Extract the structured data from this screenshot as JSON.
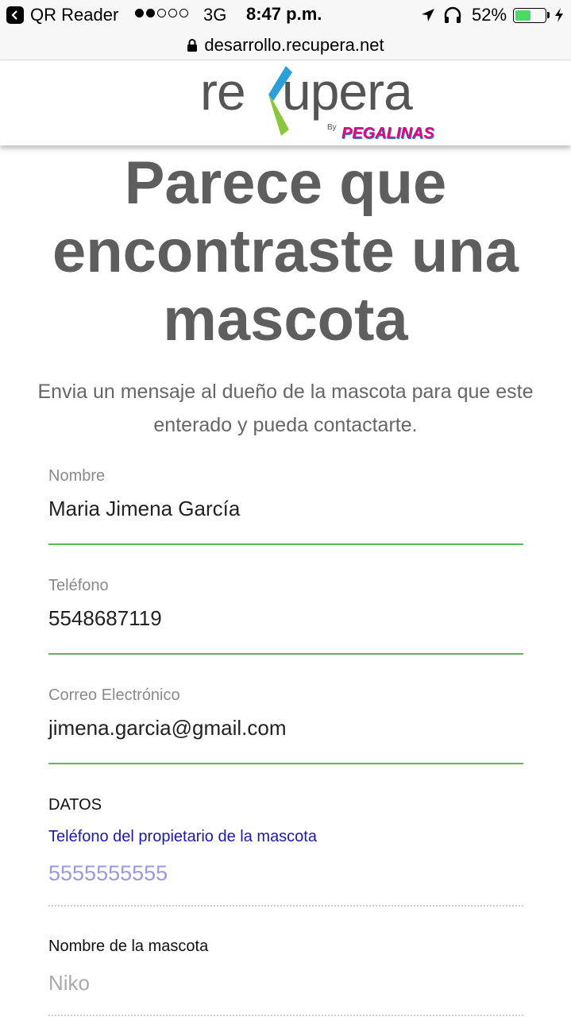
{
  "status_bar": {
    "app_name": "QR Reader",
    "network": "3G",
    "time": "8:47 p.m.",
    "battery": "52%",
    "battery_level": 0.52,
    "battery_color": "#4cd964"
  },
  "url_bar": {
    "url": "desarrollo.recupera.net",
    "icon": "lock-icon"
  },
  "header": {
    "logo_text_1": "re",
    "logo_text_2": "upera",
    "logo_by": "By",
    "logo_brand": "PEGALINAS",
    "logo_colors": [
      "#2a9fd8",
      "#8cc63f",
      "#e6007e"
    ]
  },
  "main": {
    "headline_lines": [
      "Parece que",
      "encontraste una",
      "mascota"
    ],
    "subtext": "Envia un mensaje al dueño de la mascota para que este enterado y pueda contactarte.",
    "form": {
      "name": {
        "label": "Nombre",
        "value": "Maria Jimena García"
      },
      "phone": {
        "label": "Teléfono",
        "value": "5548687119"
      },
      "email": {
        "label": "Correo Electrónico",
        "value": "jimena.garcia@gmail.com"
      },
      "underline_color": "#5cb85c"
    },
    "datos": {
      "title": "DATOS",
      "owner_phone_label": "Teléfono del propietario de la mascota",
      "owner_phone_value": "5555555555",
      "pet_name_label": "Nombre de la mascota",
      "pet_name_value": "Niko"
    }
  }
}
